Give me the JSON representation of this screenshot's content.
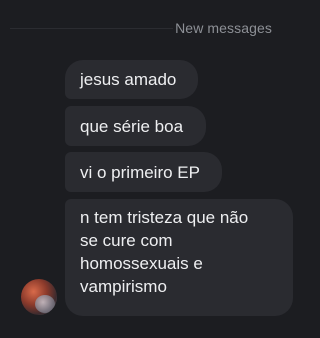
{
  "divider": {
    "label": "New messages"
  },
  "messages": [
    {
      "text": "jesus amado"
    },
    {
      "text": "que série boa"
    },
    {
      "text": "vi o primeiro EP"
    },
    {
      "text": "n tem tristeza que não\nse cure com\nhomossexuais e\nvampirismo"
    }
  ],
  "colors": {
    "background": "#1c1d21",
    "bubble": "#2a2b30",
    "text": "#eeeff1",
    "divider_text": "#8d9096"
  }
}
